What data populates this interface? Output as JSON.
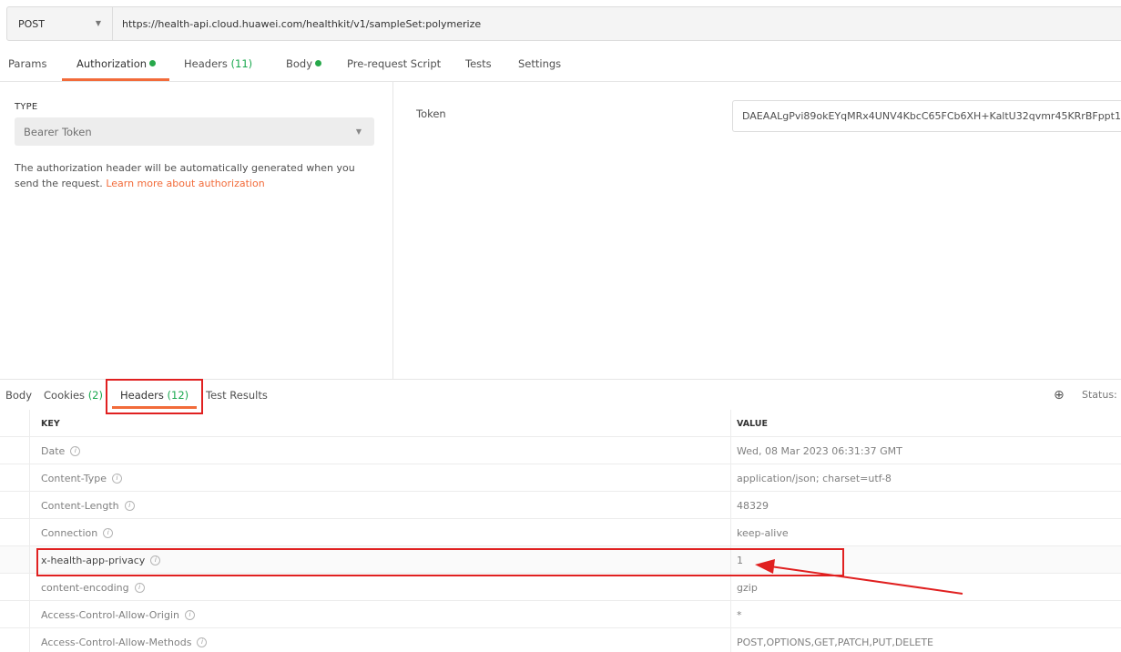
{
  "request": {
    "method": "POST",
    "url": "https://health-api.cloud.huawei.com/healthkit/v1/sampleSet:polymerize"
  },
  "req_tabs": {
    "params": "Params",
    "authorization": "Authorization",
    "headers": "Headers",
    "headers_count": "(11)",
    "body": "Body",
    "prerequest": "Pre-request Script",
    "tests": "Tests",
    "settings": "Settings"
  },
  "auth": {
    "type_label": "TYPE",
    "type_value": "Bearer Token",
    "desc": "The authorization header will be automatically generated when you send the request.",
    "link": "Learn more about authorization",
    "token_label": "Token",
    "token_value": "DAEAALgPvi89okEYqMRx4UNV4KbcC65FCb6XH+KaltU32qvmr45KRrBFppt1"
  },
  "resp_tabs": {
    "body": "Body",
    "cookies": "Cookies",
    "cookies_count": "(2)",
    "headers": "Headers",
    "headers_count": "(12)",
    "test_results": "Test Results",
    "status": "Status:"
  },
  "headers_table": {
    "key_col": "KEY",
    "value_col": "VALUE",
    "rows": [
      {
        "key": "Date",
        "value": "Wed, 08 Mar 2023 06:31:37 GMT"
      },
      {
        "key": "Content-Type",
        "value": "application/json; charset=utf-8"
      },
      {
        "key": "Content-Length",
        "value": "48329"
      },
      {
        "key": "Connection",
        "value": "keep-alive"
      },
      {
        "key": "x-health-app-privacy",
        "value": "1"
      },
      {
        "key": "content-encoding",
        "value": "gzip"
      },
      {
        "key": "Access-Control-Allow-Origin",
        "value": "*"
      },
      {
        "key": "Access-Control-Allow-Methods",
        "value": "POST,OPTIONS,GET,PATCH,PUT,DELETE"
      }
    ]
  },
  "colors": {
    "accent": "#f26b3a",
    "count_green": "#19a84e",
    "annotation_red": "#e02020"
  }
}
